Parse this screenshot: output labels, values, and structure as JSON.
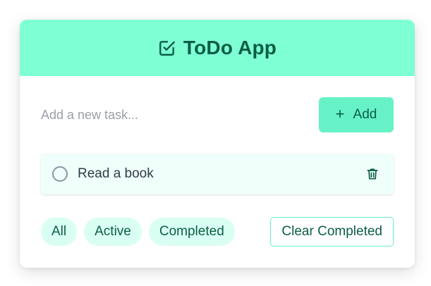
{
  "app": {
    "title": "ToDo App",
    "header_icon": "checkbox-pen-icon",
    "accent_color": "#7fffd4",
    "button_color": "#66f2c6",
    "text_color": "#0b5d47"
  },
  "input": {
    "placeholder": "Add a new task...",
    "value": ""
  },
  "add_button": {
    "label": "Add",
    "icon": "plus-icon",
    "icon_glyph": "+"
  },
  "tasks": [
    {
      "text": "Read a book",
      "completed": false
    }
  ],
  "filters": [
    {
      "label": "All"
    },
    {
      "label": "Active"
    },
    {
      "label": "Completed"
    }
  ],
  "clear_button": {
    "label": "Clear Completed"
  }
}
